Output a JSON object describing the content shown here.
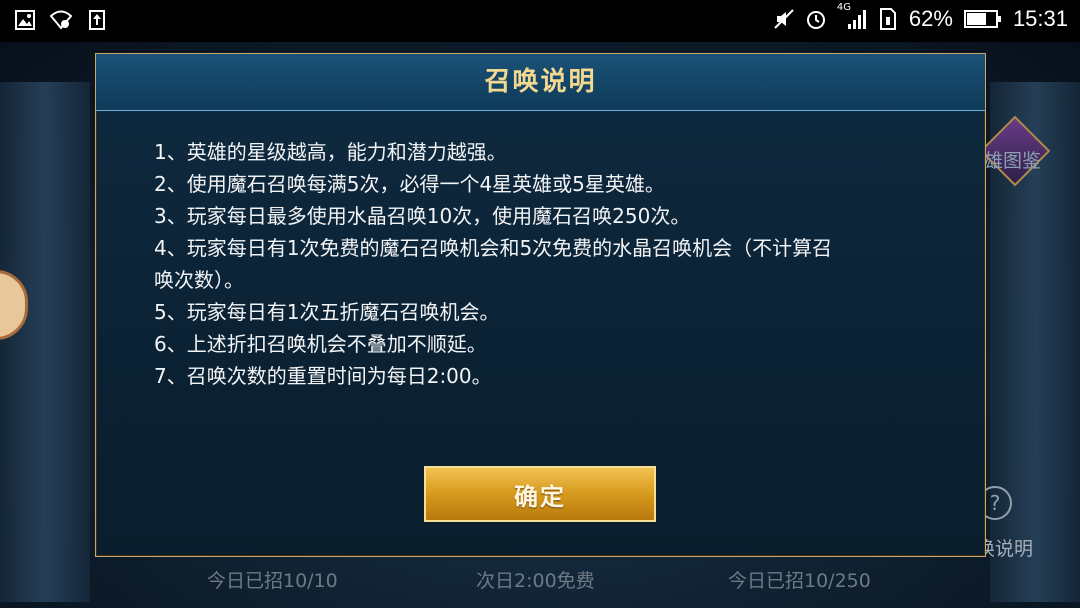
{
  "status_bar": {
    "battery_percent": "62%",
    "time": "15:31",
    "network": "4G",
    "icons": [
      "image-icon",
      "wifi-icon",
      "upload-icon",
      "mute-icon",
      "alarm-icon",
      "signal-icon",
      "sim-icon",
      "battery-icon"
    ]
  },
  "background": {
    "left_label": "今日已招10/10",
    "center_label": "次日2:00免费",
    "right_label": "今日已招10/250",
    "side_label_top": "雄图鉴",
    "side_label_bottom": "唤说明",
    "help_symbol": "?"
  },
  "dialog": {
    "title": "召唤说明",
    "rules": [
      "1、英雄的星级越高，能力和潜力越强。",
      "2、使用魔石召唤每满5次，必得一个4星英雄或5星英雄。",
      "3、玩家每日最多使用水晶召唤10次，使用魔石召唤250次。",
      "4、玩家每日有1次免费的魔石召唤机会和5次免费的水晶召唤机会（不计算召",
      "唤次数）。",
      "5、玩家每日有1次五折魔石召唤机会。",
      "6、上述折扣召唤机会不叠加不顺延。",
      "7、召唤次数的重置时间为每日2:00。"
    ],
    "confirm_label": "确定"
  },
  "colors": {
    "title": "#f2d890",
    "button": "#d69a1e",
    "dialog_bg": "#0b2234",
    "border": "#c9a86a"
  }
}
